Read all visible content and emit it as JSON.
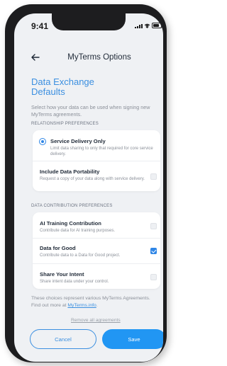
{
  "status_bar": {
    "time": "9:41"
  },
  "header": {
    "title": "MyTerms Options"
  },
  "page": {
    "heading_line1": "Data Exchange",
    "heading_line2": "Defaults",
    "intro": "Select how your data can be used when signing new MyTerms agreements."
  },
  "relationship": {
    "section_title": "RELATIONSHIP PREFERENCES",
    "items": [
      {
        "label": "Service Delivery Only",
        "description": "Limit data sharing to only that required for core service delivery.",
        "selected": true
      },
      {
        "label": "Include Data Portability",
        "description": "Request a copy of your data along with service delivery.",
        "checked": false
      }
    ]
  },
  "contribution": {
    "section_title": "DATA CONTRIBUTION PREFERENCES",
    "items": [
      {
        "label": "AI Training Contribution",
        "description": "Contribute data for AI training purposes.",
        "checked": false
      },
      {
        "label": "Data for Good",
        "description": "Contribute data to a Data for Good project.",
        "checked": true
      },
      {
        "label": "Share Your Intent",
        "description": "Share intent data under your control.",
        "checked": false
      }
    ]
  },
  "footer": {
    "note": "These choices represent various MyTerms Agreements. Find out more at",
    "link": "MyTerms.info",
    "period": ".",
    "remove_link": "Remove all agreements"
  },
  "actions": {
    "cancel": "Cancel",
    "save": "Save"
  },
  "colors": {
    "accent": "#2196f3",
    "link": "#3b8fe0",
    "background": "#eff1f4"
  }
}
